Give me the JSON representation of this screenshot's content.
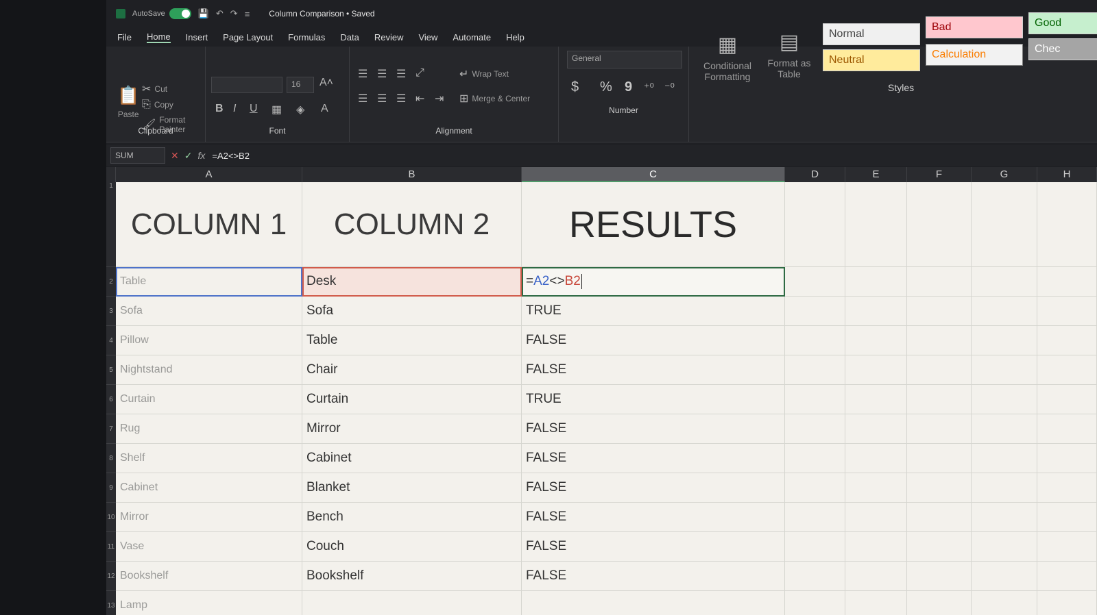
{
  "titlebar": {
    "autosave_label": "AutoSave",
    "autosave_state": "On",
    "doc_title": "Column Comparison • Saved"
  },
  "tabs": [
    "File",
    "Home",
    "Insert",
    "Page Layout",
    "Formulas",
    "Data",
    "Review",
    "View",
    "Automate",
    "Help"
  ],
  "ribbon": {
    "clipboard": {
      "paste": "Paste",
      "cut": "Cut",
      "copy": "Copy",
      "format_painter": "Format Painter",
      "label": "Clipboard"
    },
    "font": {
      "font_name": "",
      "font_size": "16",
      "label": "Font"
    },
    "alignment": {
      "wrap_text": "Wrap Text",
      "merge_center": "Merge & Center",
      "label": "Alignment"
    },
    "number": {
      "format": "General",
      "currency": "$",
      "percent": "%",
      "comma": "9",
      "label": "Number"
    },
    "conditional_formatting": "Conditional Formatting",
    "format_as_table": "Format as Table",
    "styles": {
      "normal": "Normal",
      "bad": "Bad",
      "good": "Good",
      "neutral": "Neutral",
      "calculation": "Calculation",
      "check": "Chec",
      "label": "Styles"
    }
  },
  "formula_bar": {
    "name_box": "SUM",
    "formula": "=A2<>B2"
  },
  "columns": [
    "A",
    "B",
    "C",
    "D",
    "E",
    "F",
    "G",
    "H"
  ],
  "header_row": {
    "a": "COLUMN 1",
    "b": "COLUMN 2",
    "c": "RESULTS"
  },
  "edit_cell": {
    "eq": "=",
    "ref_a": "A2",
    "op": "<>",
    "ref_b": "B2"
  },
  "rows": [
    {
      "n": "2",
      "a": "Table",
      "b": "Desk",
      "c": ""
    },
    {
      "n": "3",
      "a": "Sofa",
      "b": "Sofa",
      "c": "TRUE"
    },
    {
      "n": "4",
      "a": "Pillow",
      "b": "Table",
      "c": "FALSE"
    },
    {
      "n": "5",
      "a": "Nightstand",
      "b": "Chair",
      "c": "FALSE"
    },
    {
      "n": "6",
      "a": "Curtain",
      "b": "Curtain",
      "c": "TRUE"
    },
    {
      "n": "7",
      "a": "Rug",
      "b": "Mirror",
      "c": "FALSE"
    },
    {
      "n": "8",
      "a": "Shelf",
      "b": "Cabinet",
      "c": "FALSE"
    },
    {
      "n": "9",
      "a": "Cabinet",
      "b": "Blanket",
      "c": "FALSE"
    },
    {
      "n": "10",
      "a": "Mirror",
      "b": "Bench",
      "c": "FALSE"
    },
    {
      "n": "11",
      "a": "Vase",
      "b": "Couch",
      "c": "FALSE"
    },
    {
      "n": "12",
      "a": "Bookshelf",
      "b": "Bookshelf",
      "c": "FALSE"
    },
    {
      "n": "13",
      "a": "Lamp",
      "b": "",
      "c": ""
    }
  ]
}
